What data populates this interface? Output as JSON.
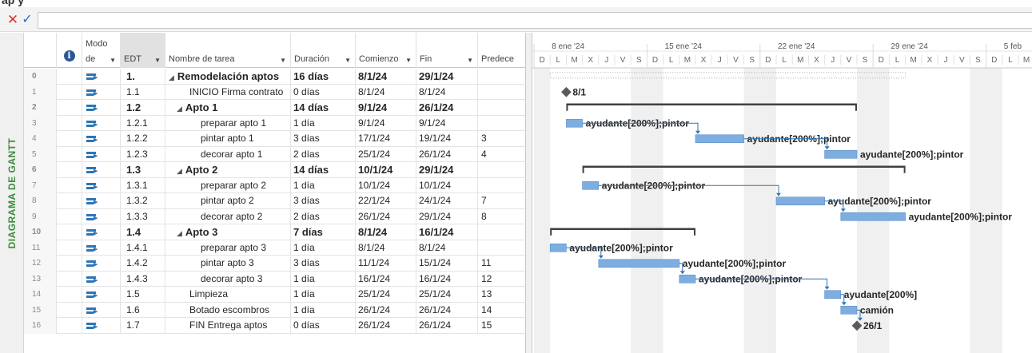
{
  "view_label": "DIAGRAMA DE GANTT",
  "entry_bar": {
    "cancel_icon": "cross-icon",
    "enter_icon": "check-icon",
    "value": ""
  },
  "columns": {
    "mode_line1": "Modo",
    "mode_line2": "de",
    "edt": "EDT",
    "name": "Nombre de tarea",
    "duration": "Duración",
    "start": "Comienzo",
    "end": "Fin",
    "pred": "Predece"
  },
  "timeline": {
    "weeks": [
      "8 ene '24",
      "15 ene '24",
      "22 ene '24",
      "29 ene '24",
      "5 feb"
    ],
    "day_letters": [
      "D",
      "L",
      "M",
      "X",
      "J",
      "V",
      "S"
    ]
  },
  "tasks": [
    {
      "id": "0",
      "edt": "1.",
      "name": "Remodelación aptos",
      "duration": "16 días",
      "start": "8/1/24",
      "end": "29/1/24",
      "pred": "",
      "level": 0,
      "summary": true
    },
    {
      "id": "1",
      "edt": "1.1",
      "name": "INICIO Firma contrato",
      "duration": "0 días",
      "start": "8/1/24",
      "end": "8/1/24",
      "pred": "",
      "level": 1,
      "summary": false
    },
    {
      "id": "2",
      "edt": "1.2",
      "name": "Apto 1",
      "duration": "14 días",
      "start": "9/1/24",
      "end": "26/1/24",
      "pred": "",
      "level": 1,
      "summary": true
    },
    {
      "id": "3",
      "edt": "1.2.1",
      "name": "preparar apto 1",
      "duration": "1 día",
      "start": "9/1/24",
      "end": "9/1/24",
      "pred": "",
      "level": 2,
      "summary": false
    },
    {
      "id": "4",
      "edt": "1.2.2",
      "name": "pintar apto 1",
      "duration": "3 días",
      "start": "17/1/24",
      "end": "19/1/24",
      "pred": "3",
      "level": 2,
      "summary": false
    },
    {
      "id": "5",
      "edt": "1.2.3",
      "name": "decorar apto 1",
      "duration": "2 días",
      "start": "25/1/24",
      "end": "26/1/24",
      "pred": "4",
      "level": 2,
      "summary": false
    },
    {
      "id": "6",
      "edt": "1.3",
      "name": "Apto 2",
      "duration": "14 días",
      "start": "10/1/24",
      "end": "29/1/24",
      "pred": "",
      "level": 1,
      "summary": true
    },
    {
      "id": "7",
      "edt": "1.3.1",
      "name": "preparar apto 2",
      "duration": "1 día",
      "start": "10/1/24",
      "end": "10/1/24",
      "pred": "",
      "level": 2,
      "summary": false
    },
    {
      "id": "8",
      "edt": "1.3.2",
      "name": "pintar apto 2",
      "duration": "3 días",
      "start": "22/1/24",
      "end": "24/1/24",
      "pred": "7",
      "level": 2,
      "summary": false
    },
    {
      "id": "9",
      "edt": "1.3.3",
      "name": "decorar apto 2",
      "duration": "2 días",
      "start": "26/1/24",
      "end": "29/1/24",
      "pred": "8",
      "level": 2,
      "summary": false
    },
    {
      "id": "10",
      "edt": "1.4",
      "name": "Apto 3",
      "duration": "7 días",
      "start": "8/1/24",
      "end": "16/1/24",
      "pred": "",
      "level": 1,
      "summary": true
    },
    {
      "id": "11",
      "edt": "1.4.1",
      "name": "preparar apto 3",
      "duration": "1 día",
      "start": "8/1/24",
      "end": "8/1/24",
      "pred": "",
      "level": 2,
      "summary": false
    },
    {
      "id": "12",
      "edt": "1.4.2",
      "name": "pintar apto 3",
      "duration": "3 días",
      "start": "11/1/24",
      "end": "15/1/24",
      "pred": "11",
      "level": 2,
      "summary": false
    },
    {
      "id": "13",
      "edt": "1.4.3",
      "name": "decorar apto 3",
      "duration": "1 día",
      "start": "16/1/24",
      "end": "16/1/24",
      "pred": "12",
      "level": 2,
      "summary": false
    },
    {
      "id": "14",
      "edt": "1.5",
      "name": "Limpieza",
      "duration": "1 día",
      "start": "25/1/24",
      "end": "25/1/24",
      "pred": "13",
      "level": 1,
      "summary": false
    },
    {
      "id": "15",
      "edt": "1.6",
      "name": "Botado escombros",
      "duration": "1 día",
      "start": "26/1/24",
      "end": "26/1/24",
      "pred": "14",
      "level": 1,
      "summary": false
    },
    {
      "id": "16",
      "edt": "1.7",
      "name": "FIN Entrega aptos",
      "duration": "0 días",
      "start": "26/1/24",
      "end": "26/1/24",
      "pred": "15",
      "level": 1,
      "summary": false
    }
  ],
  "gantt_bars": [
    {
      "row": 0,
      "kind": "project_summary",
      "start": "8/1/24",
      "end": "29/1/24",
      "label": ""
    },
    {
      "row": 1,
      "kind": "milestone",
      "start": "8/1/24",
      "end": "8/1/24",
      "label": "8/1"
    },
    {
      "row": 2,
      "kind": "summary",
      "start": "9/1/24",
      "end": "26/1/24",
      "label": ""
    },
    {
      "row": 3,
      "kind": "task",
      "start": "9/1/24",
      "end": "9/1/24",
      "label": "ayudante[200%];pintor"
    },
    {
      "row": 4,
      "kind": "task",
      "start": "17/1/24",
      "end": "19/1/24",
      "label": "ayudante[200%];pintor"
    },
    {
      "row": 5,
      "kind": "task",
      "start": "25/1/24",
      "end": "26/1/24",
      "label": "ayudante[200%];pintor"
    },
    {
      "row": 6,
      "kind": "summary",
      "start": "10/1/24",
      "end": "29/1/24",
      "label": ""
    },
    {
      "row": 7,
      "kind": "task",
      "start": "10/1/24",
      "end": "10/1/24",
      "label": "ayudante[200%];pintor"
    },
    {
      "row": 8,
      "kind": "task",
      "start": "22/1/24",
      "end": "24/1/24",
      "label": "ayudante[200%];pintor"
    },
    {
      "row": 9,
      "kind": "task",
      "start": "26/1/24",
      "end": "29/1/24",
      "label": "ayudante[200%];pintor"
    },
    {
      "row": 10,
      "kind": "summary",
      "start": "8/1/24",
      "end": "16/1/24",
      "label": ""
    },
    {
      "row": 11,
      "kind": "task",
      "start": "8/1/24",
      "end": "8/1/24",
      "label": "ayudante[200%];pintor"
    },
    {
      "row": 12,
      "kind": "task",
      "start": "11/1/24",
      "end": "15/1/24",
      "label": "ayudante[200%];pintor"
    },
    {
      "row": 13,
      "kind": "task",
      "start": "16/1/24",
      "end": "16/1/24",
      "label": "ayudante[200%];pintor"
    },
    {
      "row": 14,
      "kind": "task",
      "start": "25/1/24",
      "end": "25/1/24",
      "label": "ayudante[200%]"
    },
    {
      "row": 15,
      "kind": "task",
      "start": "26/1/24",
      "end": "26/1/24",
      "label": "camión"
    },
    {
      "row": 16,
      "kind": "milestone",
      "start": "26/1/24",
      "end": "26/1/24",
      "label": "26/1"
    }
  ],
  "links": [
    {
      "from": 3,
      "to": 4
    },
    {
      "from": 4,
      "to": 5
    },
    {
      "from": 7,
      "to": 8
    },
    {
      "from": 8,
      "to": 9
    },
    {
      "from": 11,
      "to": 12
    },
    {
      "from": 12,
      "to": 13
    },
    {
      "from": 13,
      "to": 14
    },
    {
      "from": 14,
      "to": 15
    },
    {
      "from": 15,
      "to": 16
    }
  ],
  "colors": {
    "bar": "#7eaedf",
    "bar_stroke": "#5b8fc9",
    "summary": "#404040",
    "link": "#2e75b6",
    "weekend_shade": "#f0f0f0",
    "accent_green": "#3d8b3d"
  }
}
